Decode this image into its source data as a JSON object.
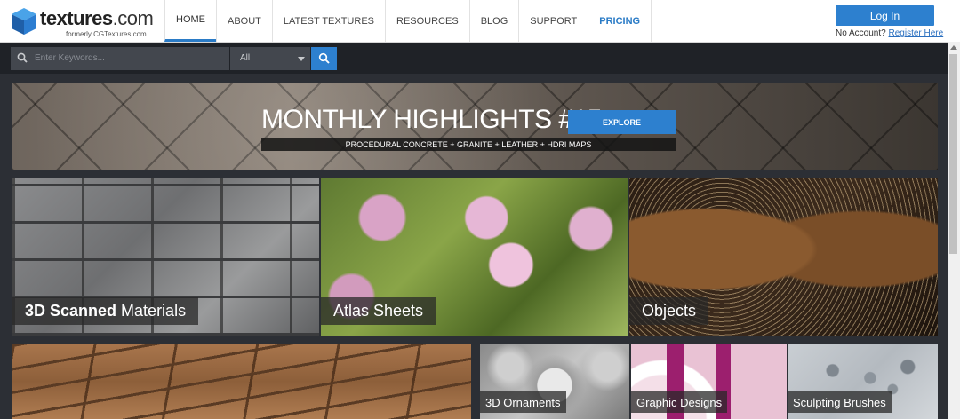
{
  "header": {
    "logo": {
      "name": "textures",
      "tld": ".com",
      "subtitle": "formerly CGTextures.com"
    },
    "nav": [
      {
        "label": "HOME",
        "active": true
      },
      {
        "label": "ABOUT"
      },
      {
        "label": "LATEST TEXTURES"
      },
      {
        "label": "RESOURCES"
      },
      {
        "label": "BLOG"
      },
      {
        "label": "SUPPORT"
      },
      {
        "label": "PRICING",
        "highlight": true
      }
    ],
    "login_label": "Log In",
    "no_account_text": "No Account?",
    "register_label": "Register Here"
  },
  "search": {
    "placeholder": "Enter Keywords...",
    "category": "All",
    "button_icon": "search-icon"
  },
  "banner": {
    "title": "MONTHLY HIGHLIGHTS #15",
    "explore_label": "EXPLORE",
    "subtitle": "PROCEDURAL CONCRETE + GRANITE + LEATHER + HDRI MAPS"
  },
  "tiles": [
    {
      "label_bold": "3D Scanned",
      "label": "Materials"
    },
    {
      "label": "Atlas Sheets"
    },
    {
      "label": "Objects"
    },
    {
      "label": ""
    },
    {
      "label": "3D Ornaments"
    },
    {
      "label": "Graphic Designs"
    },
    {
      "label": "Sculpting Brushes"
    }
  ],
  "colors": {
    "accent": "#2d80cf",
    "dark_bg": "#2c2f35",
    "search_bg": "#1f2227"
  }
}
